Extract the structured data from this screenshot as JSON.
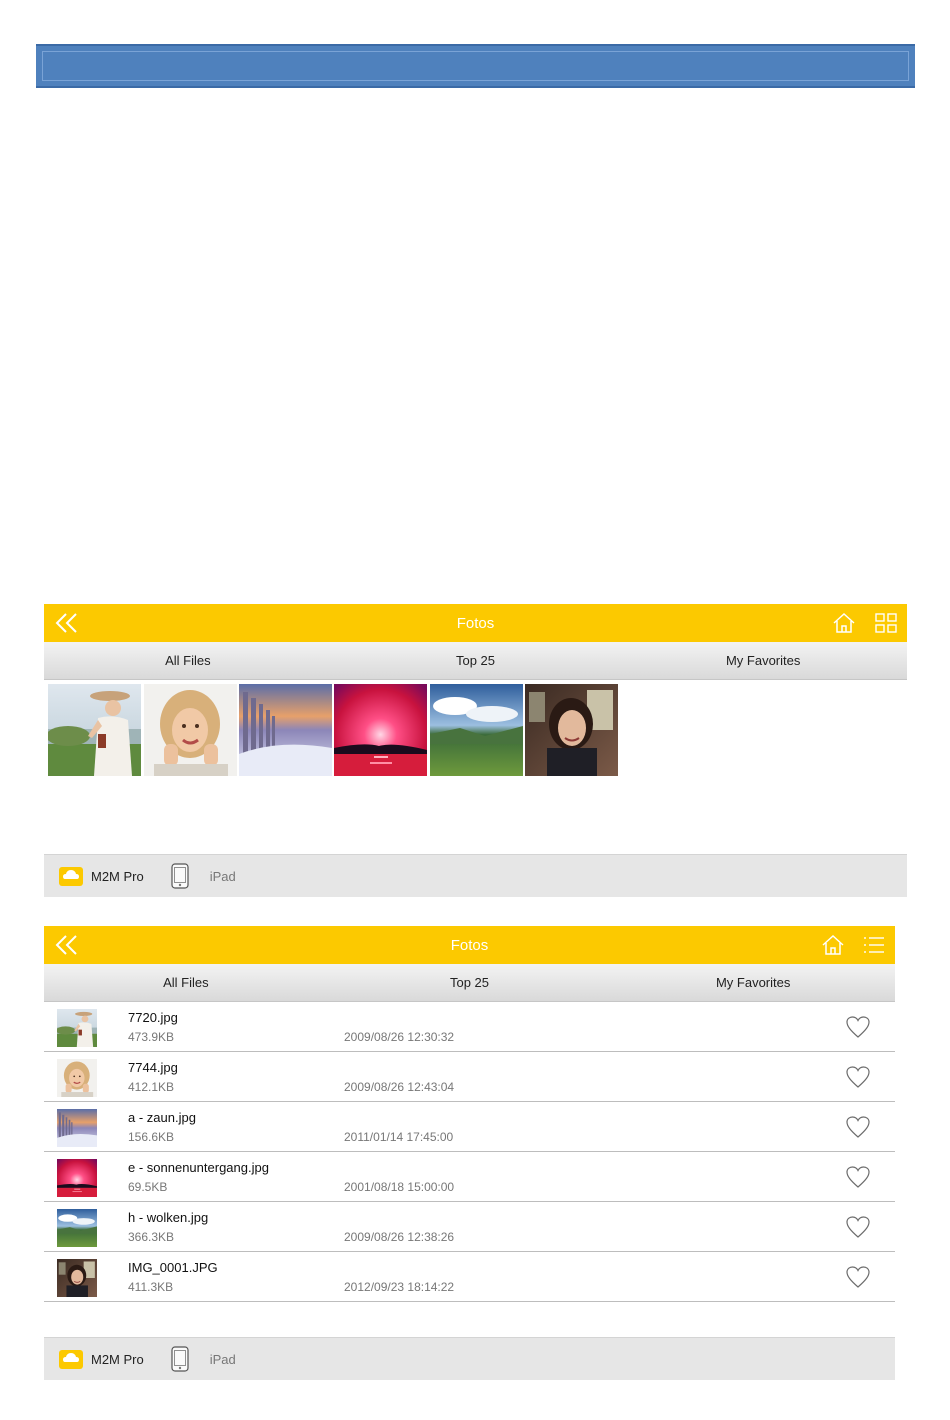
{
  "colors": {
    "accent": "#fcc900",
    "banner": "#4f81bd",
    "footer_bg": "#e6e6e6"
  },
  "grid_screen": {
    "header": {
      "title": "Fotos",
      "back_icon": "double-chevron-left-icon",
      "home_icon": "home-icon",
      "view_icon": "grid-view-icon"
    },
    "tabs": [
      "All Files",
      "Top 25",
      "My Favorites"
    ],
    "thumbnails": [
      "7720.jpg",
      "7744.jpg",
      "a - zaun.jpg",
      "e - sonnenuntergang.jpg",
      "h - wolken.jpg",
      "IMG_0001.JPG"
    ],
    "footer": {
      "cloud_label": "M2M Pro",
      "device_label": "iPad"
    }
  },
  "list_screen": {
    "header": {
      "title": "Fotos",
      "back_icon": "double-chevron-left-icon",
      "home_icon": "home-icon",
      "view_icon": "list-view-icon"
    },
    "tabs": [
      "All Files",
      "Top 25",
      "My Favorites"
    ],
    "rows": [
      {
        "name": "7720.jpg",
        "size": "473.9KB",
        "date": "2009/08/26 12:30:32"
      },
      {
        "name": "7744.jpg",
        "size": "412.1KB",
        "date": "2009/08/26 12:43:04"
      },
      {
        "name": "a - zaun.jpg",
        "size": "156.6KB",
        "date": "2011/01/14 17:45:00"
      },
      {
        "name": "e - sonnenuntergang.jpg",
        "size": "69.5KB",
        "date": "2001/08/18 15:00:00"
      },
      {
        "name": "h - wolken.jpg",
        "size": "366.3KB",
        "date": "2009/08/26 12:38:26"
      },
      {
        "name": "IMG_0001.JPG",
        "size": "411.3KB",
        "date": "2012/09/23 18:14:22"
      }
    ],
    "footer": {
      "cloud_label": "M2M Pro",
      "device_label": "iPad"
    }
  }
}
